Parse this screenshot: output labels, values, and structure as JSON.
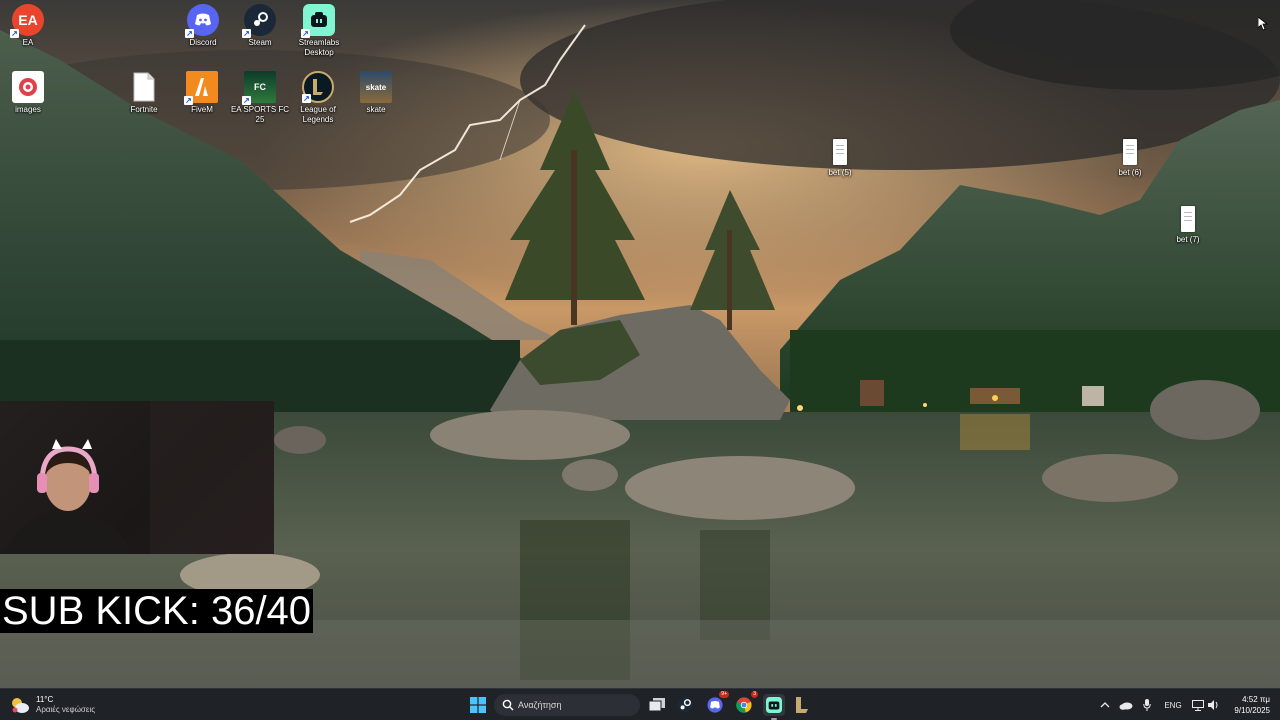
{
  "desktop": {
    "icons": [
      {
        "label": "EA",
        "icon": "ea-icon"
      },
      {
        "label": "Discord",
        "icon": "discord-icon"
      },
      {
        "label": "Steam",
        "icon": "steam-icon"
      },
      {
        "label": "Streamlabs Desktop",
        "icon": "streamlabs-icon"
      },
      {
        "label": "images",
        "icon": "images-icon"
      },
      {
        "label": "Fortnite",
        "icon": "fortnite-file-icon"
      },
      {
        "label": "FiveM",
        "icon": "fivem-icon"
      },
      {
        "label": "EA SPORTS FC 25",
        "icon": "ea-fc25-icon"
      },
      {
        "label": "League of Legends",
        "icon": "league-of-legends-icon"
      },
      {
        "label": "skate",
        "icon": "skate-icon"
      },
      {
        "label": "bet (5)",
        "icon": "file-icon"
      },
      {
        "label": "bet (6)",
        "icon": "file-icon"
      },
      {
        "label": "bet (7)",
        "icon": "file-icon"
      }
    ],
    "icon_glyphs": {
      "ea": "EA",
      "fc": "FC",
      "skate": "skate"
    }
  },
  "overlay": {
    "sub_kick_text": "SUB KICK: 36/40"
  },
  "taskbar": {
    "weather_temp": "11°C",
    "weather_desc": "Αραιές νεφώσεις",
    "search_placeholder": "Αναζήτηση",
    "apps": [
      "start-icon",
      "search-icon",
      "task-view-icon",
      "steam-icon",
      "discord-icon",
      "chrome-icon",
      "streamlabs-icon",
      "league-of-legends-icon"
    ],
    "discord_badge": "9+",
    "chrome_badge": "3",
    "language": "ENG",
    "time": "4:52 πμ",
    "date": "9/10/2025"
  },
  "colors": {
    "taskbar_bg": "#1f2227",
    "accent_blue": "#4aa3ff",
    "discord": "#5865f2",
    "streamlabs": "#80f5d2",
    "fivem": "#f28a1e",
    "overlay_bg": "#000000"
  }
}
